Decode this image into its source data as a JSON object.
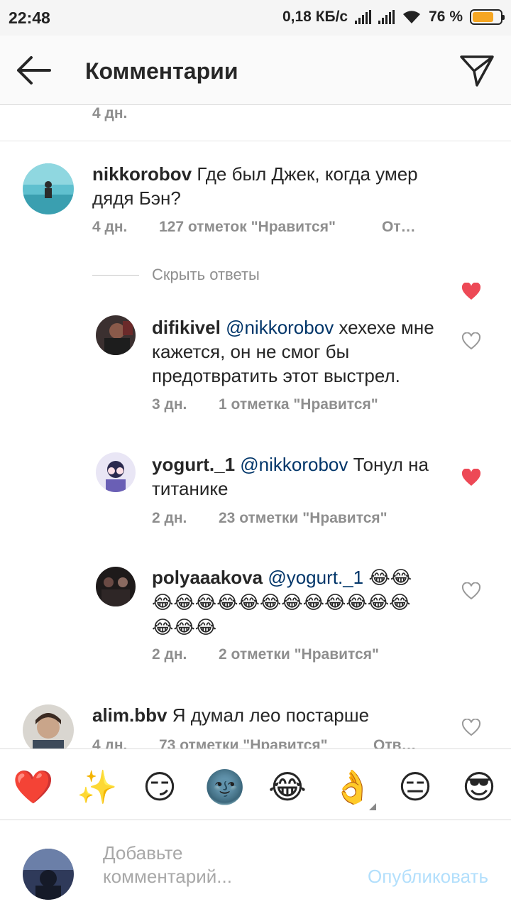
{
  "status_bar": {
    "time": "22:48",
    "speed": "0,18 КБ/с",
    "battery": "76 %",
    "battery_level": 0.76
  },
  "header": {
    "title": "Комментарии",
    "back_icon": "arrow-left-icon",
    "send_icon": "paper-plane-icon"
  },
  "prev_comment": {
    "time": "4 дн."
  },
  "comments": [
    {
      "user": "nikkorobov",
      "text": "Где был Джек, когда умер дядя Бэн?",
      "time": "4 дн.",
      "likes": "127 отметок \"Нравится\"",
      "reply": "От…",
      "liked": true
    },
    {
      "user": "alim.bbv",
      "text": "Я думал лео постарше",
      "time": "4 дн.",
      "likes": "73 отметки \"Нравится\"",
      "reply": "Отв…",
      "liked": false
    }
  ],
  "hide_replies": "Скрыть ответы",
  "replies": [
    {
      "user": "difikivel",
      "mention": "@nikkorobov",
      "text": "хехехе мне кажется, он не смог бы предотвратить этот выстрел.",
      "time": "3 дн.",
      "likes": "1 отметка \"Нравится\"",
      "liked": false
    },
    {
      "user": "yogurt._1",
      "mention": "@nikkorobov",
      "text": "Тонул на титанике",
      "time": "2 дн.",
      "likes": "23 отметки \"Нравится\"",
      "liked": true
    },
    {
      "user": "polyaaakova",
      "mention": "@yogurt._1",
      "text": "😂😂😂😂😂😂😂😂😂😂😂😂😂😂😂😂😂",
      "time": "2 дн.",
      "likes": "2 отметки \"Нравится\"",
      "liked": false
    }
  ],
  "emoji_bar": [
    "❤️",
    "✨",
    "😏",
    "🌚",
    "😂",
    "👌",
    "😑",
    "😎"
  ],
  "composer": {
    "placeholder": "Добавьте комментарий...",
    "publish": "Опубликовать"
  },
  "colors": {
    "like_red": "#ed4956",
    "mention_blue": "#003569",
    "publish_disabled": "#b2dffc"
  }
}
